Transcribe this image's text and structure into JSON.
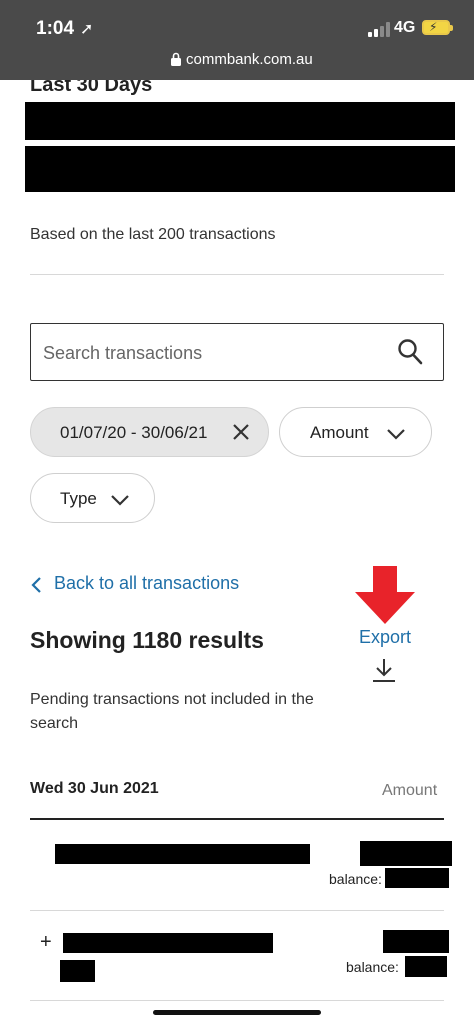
{
  "status_bar": {
    "time": "1:04",
    "network": "4G",
    "url": "commbank.com.au"
  },
  "summary": {
    "period_title": "Last 30 Days",
    "based_on": "Based on the last 200 transactions"
  },
  "search": {
    "placeholder": "Search transactions"
  },
  "filters": {
    "date_range": "01/07/20 - 30/06/21",
    "amount": "Amount",
    "type": "Type"
  },
  "nav": {
    "back_label": "Back to all transactions"
  },
  "results": {
    "title": "Showing 1180 results",
    "export_label": "Export",
    "pending_note": "Pending transactions not included in the search"
  },
  "transactions": {
    "date_header": "Wed 30 Jun 2021",
    "amount_header": "Amount",
    "rows": [
      {
        "sign": "",
        "balance_label": "balance:"
      },
      {
        "sign": "+",
        "balance_label": "balance:"
      }
    ]
  },
  "colors": {
    "status_bar": "#4a4a4a",
    "link": "#1f6fa8",
    "annotation_arrow": "#e8232a",
    "active_chip": "#e6e6e6"
  }
}
